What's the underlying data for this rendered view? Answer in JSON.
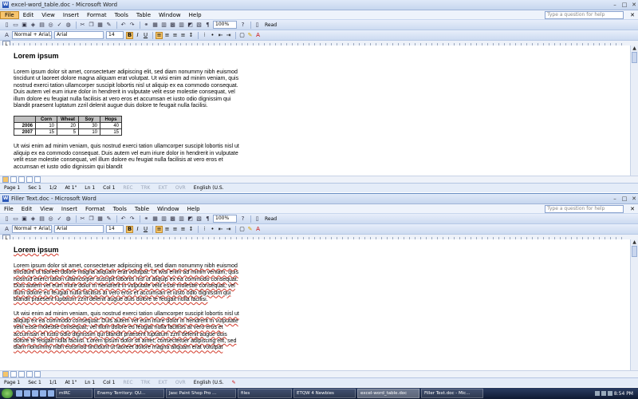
{
  "windows": [
    {
      "title": "excel-word_table.doc - Microsoft Word",
      "menu": [
        "File",
        "Edit",
        "View",
        "Insert",
        "Format",
        "Tools",
        "Table",
        "Window",
        "Help"
      ],
      "ask_placeholder": "Type a question for help",
      "toolbar": {
        "zoom": "100%",
        "read_label": "Read"
      },
      "format": {
        "style": "Normal + Arial, 1",
        "font": "Arial",
        "size": "14"
      },
      "heading": "Lorem ipsum",
      "paragraphs": [
        "Lorem ipsum dolor sit amet, consectetuer adipiscing elit, sed diam nonummy nibh euismod tincidunt ut laoreet dolore magna aliquam erat volutpat. Ut wisi enim ad minim veniam, quis nostrud exerci tation ullamcorper suscipit lobortis nisl ut aliquip ex ea commodo consequat. Duis autem vel eum iriure dolor in hendrerit in vulputate velit esse molestie consequat, vel illum dolore eu feugiat nulla facilisis at vero eros et accumsan et iusto odio dignissim qui blandit praesent luptatum zzril delenit augue duis dolore te feugait nulla facilisi.",
        "Ut wisi enim ad minim veniam, quis nostrud exerci tation ullamcorper suscipit lobortis nisl ut aliquip ex ea commodo consequat. Duis autem vel eum iriure dolor in hendrerit in vulputate velit esse molestie consequat, vel illum dolore eu feugiat nulla facilisis at vero eros et accumsan et iusto odio dignissim qui blandit"
      ],
      "table": {
        "headers": [
          "",
          "Corn",
          "Wheat",
          "Soy",
          "Hops"
        ],
        "rows": [
          [
            "2006",
            "10",
            "20",
            "30",
            "40"
          ],
          [
            "2007",
            "15",
            "5",
            "10",
            "15"
          ]
        ]
      },
      "status": {
        "page": "Page 1",
        "sec": "Sec 1",
        "pages": "1/2",
        "at": "At 1\"",
        "ln": "Ln 1",
        "col": "Col 1",
        "rec": "REC",
        "trk": "TRK",
        "ext": "EXT",
        "ovr": "OVR",
        "lang": "English (U.S."
      }
    },
    {
      "title": "Filler Text.doc - Microsoft Word",
      "menu": [
        "File",
        "Edit",
        "View",
        "Insert",
        "Format",
        "Tools",
        "Table",
        "Window",
        "Help"
      ],
      "ask_placeholder": "Type a question for help",
      "toolbar": {
        "zoom": "100%",
        "read_label": "Read"
      },
      "format": {
        "style": "Normal + Arial, 1",
        "font": "Arial",
        "size": "14"
      },
      "heading": "Lorem ipsum",
      "paragraphs": [
        "Lorem ipsum dolor sit amet, consectetuer adipiscing elit, sed diam nonummy nibh euismod tincidunt ut laoreet dolore magna aliquam erat volutpat. Ut wisi enim ad minim veniam, quis nostrud exerci tation ullamcorper suscipit lobortis nisl ut aliquip ex ea commodo consequat. Duis autem vel eum iriure dolor in hendrerit in vulputate velit esse molestie consequat, vel illum dolore eu feugiat nulla facilisis at vero eros et accumsan et iusto odio dignissim qui blandit praesent luptatum zzril delenit augue duis dolore te feugait nulla facilisi.",
        "Ut wisi enim ad minim veniam, quis nostrud exerci tation ullamcorper suscipit lobortis nisl ut aliquip ex ea commodo consequat. Duis autem vel eum iriure dolor in hendrerit in vulputate velit esse molestie consequat, vel illum dolore eu feugiat nulla facilisis at vero eros et accumsan et iusto odio dignissim qui blandit praesent luptatum zzril delenit augue duis dolore te feugait nulla facilisi. Lorem ipsum dolor sit amet, consectetuer adipiscing elit, sed diam nonummy nibh euismod tincidunt ut laoreet dolore magna aliquam erat volutpat"
      ],
      "status": {
        "page": "Page 1",
        "sec": "Sec 1",
        "pages": "1/1",
        "at": "At 1\"",
        "ln": "Ln 1",
        "col": "Col 1",
        "rec": "REC",
        "trk": "TRK",
        "ext": "EXT",
        "ovr": "OVR",
        "lang": "English (U.S."
      }
    }
  ],
  "taskbar": {
    "tasks": [
      "mIRC",
      "Enemy Territory: QU...",
      "Jasc Paint Shop Pro ...",
      "files",
      "ETQW 4 Newbies",
      "excel-word_table.doc",
      "Filler Text.doc - Mic..."
    ],
    "clock": "8:54 PM"
  }
}
